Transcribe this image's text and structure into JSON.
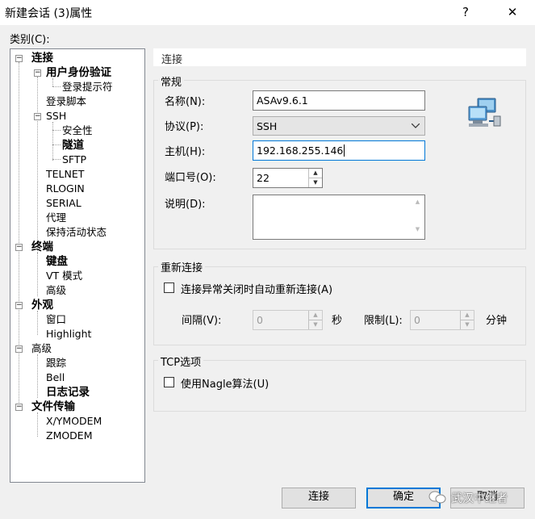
{
  "window": {
    "title": "新建会话 (3)属性",
    "help": "?",
    "close": "✕"
  },
  "category_label": "类别(C):",
  "tree": {
    "connection": "连接",
    "auth": "用户身份验证",
    "login_prompt": "登录提示符",
    "login_script": "登录脚本",
    "ssh": "SSH",
    "security": "安全性",
    "tunnel": "隧道",
    "sftp": "SFTP",
    "telnet": "TELNET",
    "rlogin": "RLOGIN",
    "serial": "SERIAL",
    "proxy": "代理",
    "keepalive": "保持活动状态",
    "terminal": "终端",
    "keyboard": "键盘",
    "vt_mode": "VT 模式",
    "advanced_term": "高级",
    "appearance": "外观",
    "window": "窗口",
    "highlight": "Highlight",
    "advanced": "高级",
    "trace": "跟踪",
    "bell": "Bell",
    "log": "日志记录",
    "file_transfer": "文件传输",
    "xymodem": "X/YMODEM",
    "zmodem": "ZMODEM"
  },
  "panel_header": "连接",
  "general": {
    "title": "常规",
    "name_label": "名称(N):",
    "name_value": "ASAv9.6.1",
    "protocol_label": "协议(P):",
    "protocol_value": "SSH",
    "host_label": "主机(H):",
    "host_value": "192.168.255.146",
    "port_label": "端口号(O):",
    "port_value": "22",
    "desc_label": "说明(D):",
    "desc_value": ""
  },
  "reconnect": {
    "title": "重新连接",
    "auto_label": "连接异常关闭时自动重新连接(A)",
    "interval_label": "间隔(V):",
    "interval_value": "0",
    "sec_unit": "秒",
    "limit_label": "限制(L):",
    "limit_value": "0",
    "min_unit": "分钟"
  },
  "tcp": {
    "title": "TCP选项",
    "nagle_label": "使用Nagle算法(U)"
  },
  "buttons": {
    "connect": "连接",
    "ok": "确定",
    "cancel": "取消"
  },
  "watermark": "武汉中继者"
}
